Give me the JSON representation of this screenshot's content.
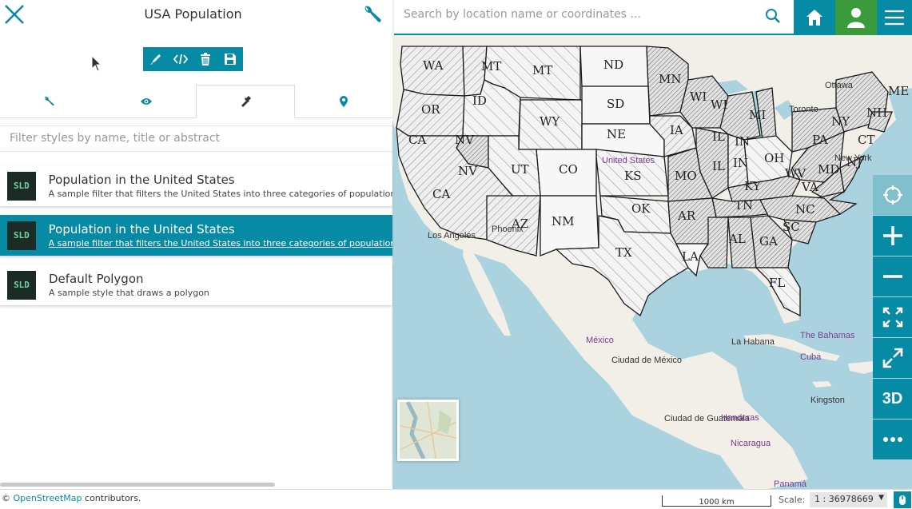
{
  "panel": {
    "title": "USA Population"
  },
  "search": {
    "placeholder": "Search by location name or coordinates ..."
  },
  "filter": {
    "placeholder": "Filter styles by name, title or abstract"
  },
  "styles": [
    {
      "thumb": "SLD",
      "title": "Population in the United States",
      "desc": "A sample filter that filters the United States into three categories of population"
    },
    {
      "thumb": "SLD",
      "title": "Population in the United States",
      "desc": "A sample filter that filters the United States into three categories of population"
    },
    {
      "thumb": "SLD",
      "title": "Default Polygon",
      "desc": "A sample style that draws a polygon"
    }
  ],
  "map": {
    "states": [
      "WA",
      "MT",
      "MT",
      "ND",
      "MN",
      "ME",
      "OR",
      "ID",
      "SD",
      "WI",
      "WI",
      "MI",
      "NH",
      "NY",
      "CA",
      "NV",
      "WY",
      "IA",
      "IL",
      "PA",
      "CT",
      "NE",
      "IN",
      "OH",
      "NJ",
      "MD",
      "CO",
      "KS",
      "MO",
      "IL",
      "IN",
      "WV",
      "NV",
      "UT",
      "KY",
      "VA",
      "CA",
      "AZ",
      "NM",
      "OK",
      "TN",
      "NC",
      "AR",
      "SC",
      "TX",
      "AL",
      "GA",
      "LA",
      "FL"
    ],
    "places": [
      "Ottawa",
      "Toronto",
      "New York",
      "United States",
      "Los Angeles",
      "Phoenix",
      "México",
      "Ciudad de México",
      "La Habana",
      "The Bahamas",
      "Cuba",
      "Kingston",
      "Ciudad de Guatemala",
      "Honduras",
      "Nicaragua",
      "Panamá"
    ]
  },
  "controls": {
    "btn_3d": "3D"
  },
  "footer": {
    "attribution_prefix": "©",
    "attribution_link": "OpenStreetMap",
    "attribution_suffix": "contributors.",
    "scalebar": "1000 km",
    "scale_label": "Scale:",
    "scale_value": "1 : 36978669"
  },
  "colors": {
    "accent": "#078aa3",
    "user_green": "#3a9a3c",
    "water": "#aad3df",
    "land": "#f2efe9"
  }
}
